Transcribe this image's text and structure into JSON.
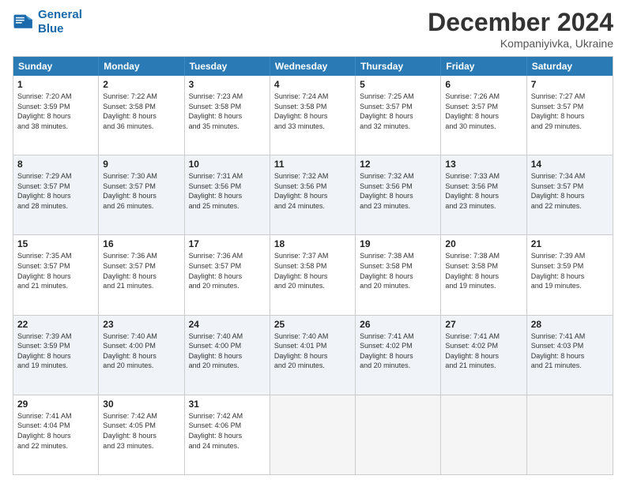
{
  "logo": {
    "line1": "General",
    "line2": "Blue"
  },
  "title": "December 2024",
  "subtitle": "Kompaniyivka, Ukraine",
  "header_days": [
    "Sunday",
    "Monday",
    "Tuesday",
    "Wednesday",
    "Thursday",
    "Friday",
    "Saturday"
  ],
  "rows": [
    [
      {
        "day": "1",
        "lines": [
          "Sunrise: 7:20 AM",
          "Sunset: 3:59 PM",
          "Daylight: 8 hours",
          "and 38 minutes."
        ]
      },
      {
        "day": "2",
        "lines": [
          "Sunrise: 7:22 AM",
          "Sunset: 3:58 PM",
          "Daylight: 8 hours",
          "and 36 minutes."
        ]
      },
      {
        "day": "3",
        "lines": [
          "Sunrise: 7:23 AM",
          "Sunset: 3:58 PM",
          "Daylight: 8 hours",
          "and 35 minutes."
        ]
      },
      {
        "day": "4",
        "lines": [
          "Sunrise: 7:24 AM",
          "Sunset: 3:58 PM",
          "Daylight: 8 hours",
          "and 33 minutes."
        ]
      },
      {
        "day": "5",
        "lines": [
          "Sunrise: 7:25 AM",
          "Sunset: 3:57 PM",
          "Daylight: 8 hours",
          "and 32 minutes."
        ]
      },
      {
        "day": "6",
        "lines": [
          "Sunrise: 7:26 AM",
          "Sunset: 3:57 PM",
          "Daylight: 8 hours",
          "and 30 minutes."
        ]
      },
      {
        "day": "7",
        "lines": [
          "Sunrise: 7:27 AM",
          "Sunset: 3:57 PM",
          "Daylight: 8 hours",
          "and 29 minutes."
        ]
      }
    ],
    [
      {
        "day": "8",
        "lines": [
          "Sunrise: 7:29 AM",
          "Sunset: 3:57 PM",
          "Daylight: 8 hours",
          "and 28 minutes."
        ]
      },
      {
        "day": "9",
        "lines": [
          "Sunrise: 7:30 AM",
          "Sunset: 3:57 PM",
          "Daylight: 8 hours",
          "and 26 minutes."
        ]
      },
      {
        "day": "10",
        "lines": [
          "Sunrise: 7:31 AM",
          "Sunset: 3:56 PM",
          "Daylight: 8 hours",
          "and 25 minutes."
        ]
      },
      {
        "day": "11",
        "lines": [
          "Sunrise: 7:32 AM",
          "Sunset: 3:56 PM",
          "Daylight: 8 hours",
          "and 24 minutes."
        ]
      },
      {
        "day": "12",
        "lines": [
          "Sunrise: 7:32 AM",
          "Sunset: 3:56 PM",
          "Daylight: 8 hours",
          "and 23 minutes."
        ]
      },
      {
        "day": "13",
        "lines": [
          "Sunrise: 7:33 AM",
          "Sunset: 3:56 PM",
          "Daylight: 8 hours",
          "and 23 minutes."
        ]
      },
      {
        "day": "14",
        "lines": [
          "Sunrise: 7:34 AM",
          "Sunset: 3:57 PM",
          "Daylight: 8 hours",
          "and 22 minutes."
        ]
      }
    ],
    [
      {
        "day": "15",
        "lines": [
          "Sunrise: 7:35 AM",
          "Sunset: 3:57 PM",
          "Daylight: 8 hours",
          "and 21 minutes."
        ]
      },
      {
        "day": "16",
        "lines": [
          "Sunrise: 7:36 AM",
          "Sunset: 3:57 PM",
          "Daylight: 8 hours",
          "and 21 minutes."
        ]
      },
      {
        "day": "17",
        "lines": [
          "Sunrise: 7:36 AM",
          "Sunset: 3:57 PM",
          "Daylight: 8 hours",
          "and 20 minutes."
        ]
      },
      {
        "day": "18",
        "lines": [
          "Sunrise: 7:37 AM",
          "Sunset: 3:58 PM",
          "Daylight: 8 hours",
          "and 20 minutes."
        ]
      },
      {
        "day": "19",
        "lines": [
          "Sunrise: 7:38 AM",
          "Sunset: 3:58 PM",
          "Daylight: 8 hours",
          "and 20 minutes."
        ]
      },
      {
        "day": "20",
        "lines": [
          "Sunrise: 7:38 AM",
          "Sunset: 3:58 PM",
          "Daylight: 8 hours",
          "and 19 minutes."
        ]
      },
      {
        "day": "21",
        "lines": [
          "Sunrise: 7:39 AM",
          "Sunset: 3:59 PM",
          "Daylight: 8 hours",
          "and 19 minutes."
        ]
      }
    ],
    [
      {
        "day": "22",
        "lines": [
          "Sunrise: 7:39 AM",
          "Sunset: 3:59 PM",
          "Daylight: 8 hours",
          "and 19 minutes."
        ]
      },
      {
        "day": "23",
        "lines": [
          "Sunrise: 7:40 AM",
          "Sunset: 4:00 PM",
          "Daylight: 8 hours",
          "and 20 minutes."
        ]
      },
      {
        "day": "24",
        "lines": [
          "Sunrise: 7:40 AM",
          "Sunset: 4:00 PM",
          "Daylight: 8 hours",
          "and 20 minutes."
        ]
      },
      {
        "day": "25",
        "lines": [
          "Sunrise: 7:40 AM",
          "Sunset: 4:01 PM",
          "Daylight: 8 hours",
          "and 20 minutes."
        ]
      },
      {
        "day": "26",
        "lines": [
          "Sunrise: 7:41 AM",
          "Sunset: 4:02 PM",
          "Daylight: 8 hours",
          "and 20 minutes."
        ]
      },
      {
        "day": "27",
        "lines": [
          "Sunrise: 7:41 AM",
          "Sunset: 4:02 PM",
          "Daylight: 8 hours",
          "and 21 minutes."
        ]
      },
      {
        "day": "28",
        "lines": [
          "Sunrise: 7:41 AM",
          "Sunset: 4:03 PM",
          "Daylight: 8 hours",
          "and 21 minutes."
        ]
      }
    ],
    [
      {
        "day": "29",
        "lines": [
          "Sunrise: 7:41 AM",
          "Sunset: 4:04 PM",
          "Daylight: 8 hours",
          "and 22 minutes."
        ]
      },
      {
        "day": "30",
        "lines": [
          "Sunrise: 7:42 AM",
          "Sunset: 4:05 PM",
          "Daylight: 8 hours",
          "and 23 minutes."
        ]
      },
      {
        "day": "31",
        "lines": [
          "Sunrise: 7:42 AM",
          "Sunset: 4:06 PM",
          "Daylight: 8 hours",
          "and 24 minutes."
        ]
      },
      null,
      null,
      null,
      null
    ]
  ]
}
